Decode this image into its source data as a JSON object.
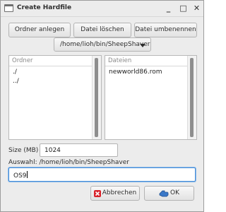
{
  "window": {
    "title": "Create Hardfile",
    "controls": {
      "minimize": "_",
      "maximize": "□",
      "close": "✕"
    }
  },
  "toolbar": {
    "create_folder": "Ordner anlegen",
    "delete_file": "Datei löschen",
    "rename_file": "Datei umbenennen"
  },
  "path_dropdown": {
    "selected": "/home/lioh/bin/SheepShaver"
  },
  "folders": {
    "header": "Ordner",
    "items": [
      "./",
      "../"
    ]
  },
  "files": {
    "header": "Dateien",
    "items": [
      "newworld86.rom"
    ]
  },
  "size": {
    "label": "Size (MB)",
    "value": "1024"
  },
  "selection": {
    "text": "Auswahl: /home/lioh/bin/SheepShaver"
  },
  "filename_input": {
    "value": "OS9"
  },
  "buttons": {
    "cancel": "Abbrechen",
    "ok": "OK"
  },
  "icons": {
    "app": "window-icon",
    "cancel": "cancel-x-icon",
    "ok": "ok-hand-icon"
  },
  "colors": {
    "cancel_icon": "#d8222a",
    "focus_ring": "#4a90d9",
    "ok_icon": "#3a78c8"
  }
}
